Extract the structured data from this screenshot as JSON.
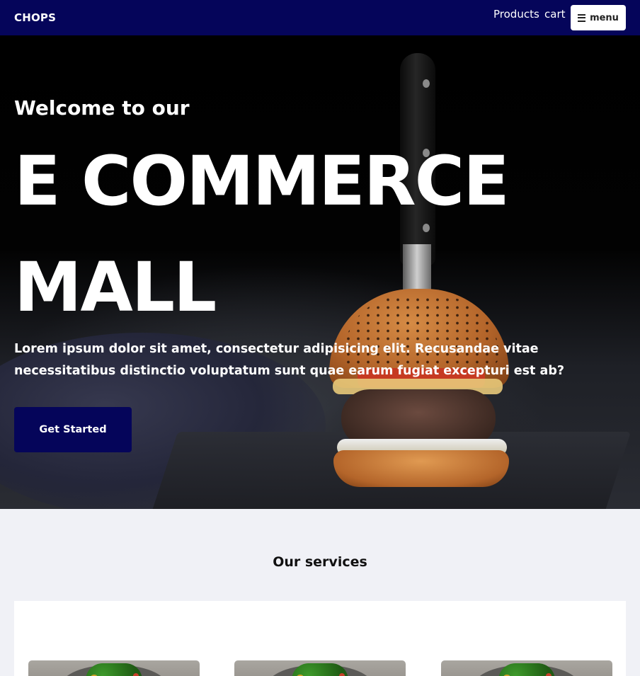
{
  "navbar": {
    "brand": "CHOPS",
    "links": {
      "products": "Products",
      "cart": "cart"
    },
    "menu_label": "menu",
    "menu_icon": "hamburger-icon",
    "background": "#05055a"
  },
  "hero": {
    "welcome": "Welcome to our",
    "title_line1": "E COMMERCE",
    "title_line2": "MALL",
    "description": "Lorem ipsum dolor sit amet, consectetur adipisicing elit. Recusandae vitae necessitatibus distinctio voluptatum sunt quae earum fugiat excepturi est ab?",
    "cta_label": "Get Started",
    "cta_color": "#05055a"
  },
  "services": {
    "title": "Our services",
    "background": "#f0f1f6"
  }
}
